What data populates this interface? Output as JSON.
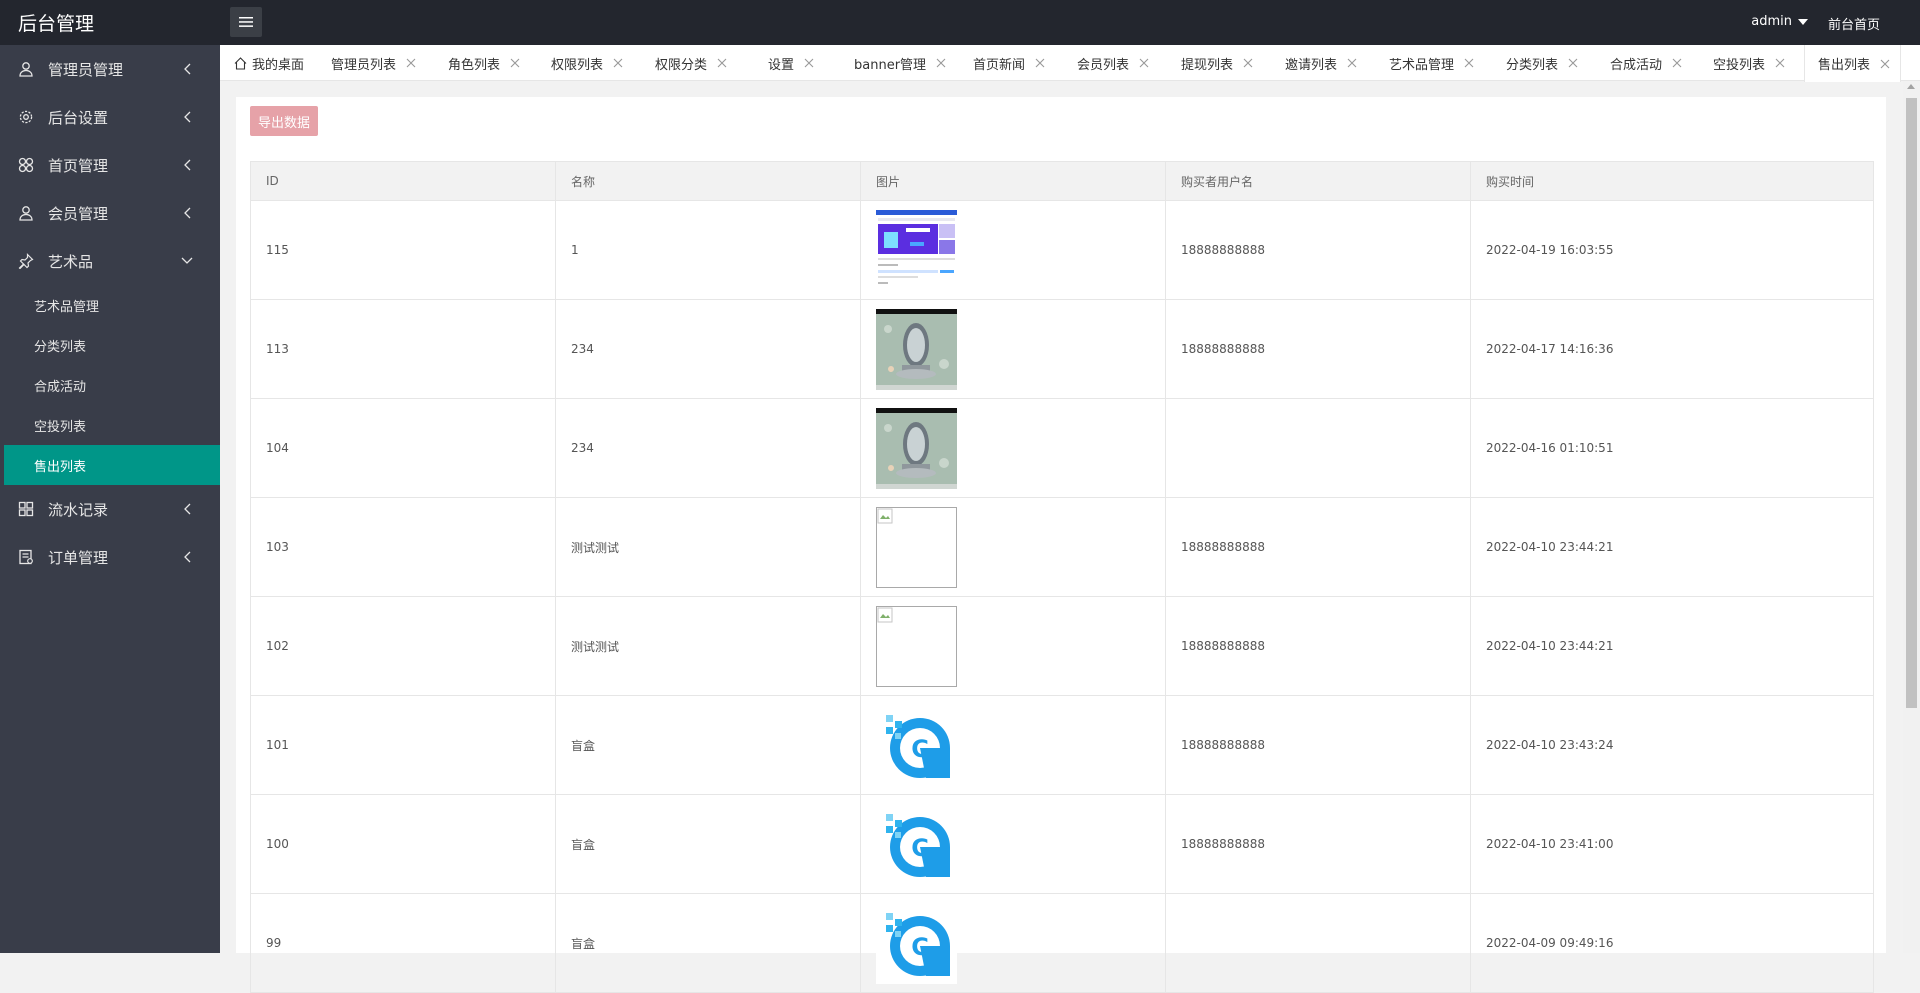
{
  "header": {
    "logo": "后台管理",
    "user": "admin",
    "front_link": "前台首页"
  },
  "sidebar": {
    "items": [
      {
        "label": "管理员管理",
        "icon": "user-icon"
      },
      {
        "label": "后台设置",
        "icon": "gear-icon"
      },
      {
        "label": "首页管理",
        "icon": "grid-icon"
      },
      {
        "label": "会员管理",
        "icon": "user-icon"
      },
      {
        "label": "艺术品",
        "icon": "pin-icon",
        "expanded": true,
        "children": [
          "艺术品管理",
          "分类列表",
          "合成活动",
          "空投列表",
          "售出列表"
        ]
      },
      {
        "label": "流水记录",
        "icon": "grid-icon"
      },
      {
        "label": "订单管理",
        "icon": "doc-icon"
      }
    ],
    "active_child": "售出列表"
  },
  "tabs": [
    {
      "label": "我的桌面"
    },
    {
      "label": "管理员列表"
    },
    {
      "label": "角色列表"
    },
    {
      "label": "权限列表"
    },
    {
      "label": "权限分类"
    },
    {
      "label": "设置"
    },
    {
      "label": "banner管理"
    },
    {
      "label": "首页新闻"
    },
    {
      "label": "会员列表"
    },
    {
      "label": "提现列表"
    },
    {
      "label": "邀请列表"
    },
    {
      "label": "艺术品管理"
    },
    {
      "label": "分类列表"
    },
    {
      "label": "合成活动"
    },
    {
      "label": "空投列表"
    },
    {
      "label": "售出列表"
    }
  ],
  "toolbar": {
    "export_label": "导出数据"
  },
  "table": {
    "columns": [
      "ID",
      "名称",
      "图片",
      "购买者用户名",
      "购买时间"
    ],
    "rows": [
      {
        "id": "115",
        "name": "1",
        "image": "screenshot-thumb",
        "buyer": "18888888888",
        "time": "2022-04-19 16:03:55"
      },
      {
        "id": "113",
        "name": "234",
        "image": "mirror-thumb",
        "buyer": "18888888888",
        "time": "2022-04-17 14:16:36"
      },
      {
        "id": "104",
        "name": "234",
        "image": "mirror-thumb",
        "buyer": "",
        "time": "2022-04-16 01:10:51"
      },
      {
        "id": "103",
        "name": "测试测试",
        "image": "broken-image",
        "buyer": "18888888888",
        "time": "2022-04-10 23:44:21"
      },
      {
        "id": "102",
        "name": "测试测试",
        "image": "broken-image",
        "buyer": "18888888888",
        "time": "2022-04-10 23:44:21"
      },
      {
        "id": "101",
        "name": "盲盒",
        "image": "c-logo",
        "buyer": "18888888888",
        "time": "2022-04-10 23:43:24"
      },
      {
        "id": "100",
        "name": "盲盒",
        "image": "c-logo",
        "buyer": "18888888888",
        "time": "2022-04-10 23:41:00"
      },
      {
        "id": "99",
        "name": "盲盒",
        "image": "c-logo",
        "buyer": "",
        "time": "2022-04-09 09:49:16"
      }
    ]
  },
  "colors": {
    "accent": "#009688",
    "header_bg": "#23262e",
    "sidebar_bg": "#393d49",
    "export_btn": "#e6a2a8"
  }
}
